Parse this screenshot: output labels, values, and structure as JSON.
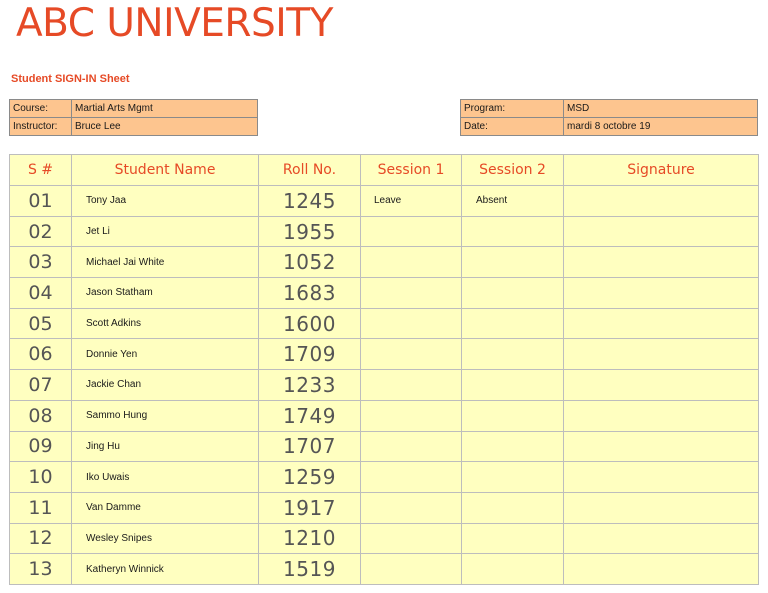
{
  "header": {
    "university": "ABC UNIVERSITY",
    "sheet_title": "Student SIGN-IN Sheet"
  },
  "info_left": {
    "course_label": "Course:",
    "course_value": "Martial Arts Mgmt",
    "instructor_label": "Instructor:",
    "instructor_value": "Bruce Lee"
  },
  "info_right": {
    "program_label": "Program:",
    "program_value": "MSD",
    "date_label": "Date:",
    "date_value": "mardi 8 octobre 19"
  },
  "table": {
    "columns": [
      "S #",
      "Student Name",
      "Roll No.",
      "Session 1",
      "Session 2",
      "Signature"
    ],
    "rows": [
      {
        "sn": "01",
        "name": "Tony Jaa",
        "roll": "1245",
        "s1": "Leave",
        "s2": "Absent",
        "sig": ""
      },
      {
        "sn": "02",
        "name": "Jet Li",
        "roll": "1955",
        "s1": "",
        "s2": "",
        "sig": ""
      },
      {
        "sn": "03",
        "name": "Michael Jai White",
        "roll": "1052",
        "s1": "",
        "s2": "",
        "sig": ""
      },
      {
        "sn": "04",
        "name": "Jason Statham",
        "roll": "1683",
        "s1": "",
        "s2": "",
        "sig": ""
      },
      {
        "sn": "05",
        "name": "Scott Adkins",
        "roll": "1600",
        "s1": "",
        "s2": "",
        "sig": ""
      },
      {
        "sn": "06",
        "name": "Donnie Yen",
        "roll": "1709",
        "s1": "",
        "s2": "",
        "sig": ""
      },
      {
        "sn": "07",
        "name": "Jackie Chan",
        "roll": "1233",
        "s1": "",
        "s2": "",
        "sig": ""
      },
      {
        "sn": "08",
        "name": "Sammo Hung",
        "roll": "1749",
        "s1": "",
        "s2": "",
        "sig": ""
      },
      {
        "sn": "09",
        "name": "Jing Hu",
        "roll": "1707",
        "s1": "",
        "s2": "",
        "sig": ""
      },
      {
        "sn": "10",
        "name": "Iko Uwais",
        "roll": "1259",
        "s1": "",
        "s2": "",
        "sig": ""
      },
      {
        "sn": "11",
        "name": "Van Damme",
        "roll": "1917",
        "s1": "",
        "s2": "",
        "sig": ""
      },
      {
        "sn": "12",
        "name": "Wesley Snipes",
        "roll": "1210",
        "s1": "",
        "s2": "",
        "sig": ""
      },
      {
        "sn": "13",
        "name": "Katheryn Winnick",
        "roll": "1519",
        "s1": "",
        "s2": "",
        "sig": ""
      }
    ]
  },
  "colors": {
    "title": "#e64a26",
    "info_fill": "#fdc58f",
    "table_fill": "#ffffc0"
  }
}
